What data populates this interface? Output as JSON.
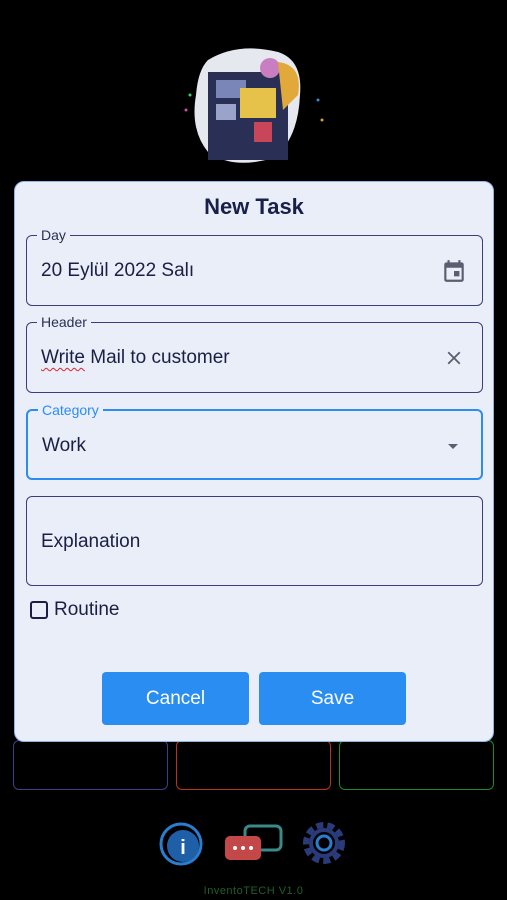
{
  "app": {
    "version": "InventoTECH V1.0"
  },
  "dialog": {
    "title": "New Task",
    "day": {
      "label": "Day",
      "value": "20 Eylül 2022 Salı",
      "icon": "calendar-icon"
    },
    "header": {
      "label": "Header",
      "value_misspelled": "Write",
      "value_rest": " Mail to customer",
      "icon": "close-icon"
    },
    "category": {
      "label": "Category",
      "value": "Work",
      "icon": "dropdown-arrow-icon"
    },
    "explanation": {
      "placeholder": "Explanation"
    },
    "routine": {
      "label": "Routine",
      "checked": false
    },
    "cancel_label": "Cancel",
    "save_label": "Save"
  },
  "colors": {
    "accent": "#2a8df2",
    "dialog_bg": "#e9eef8",
    "text": "#1b1f45"
  }
}
